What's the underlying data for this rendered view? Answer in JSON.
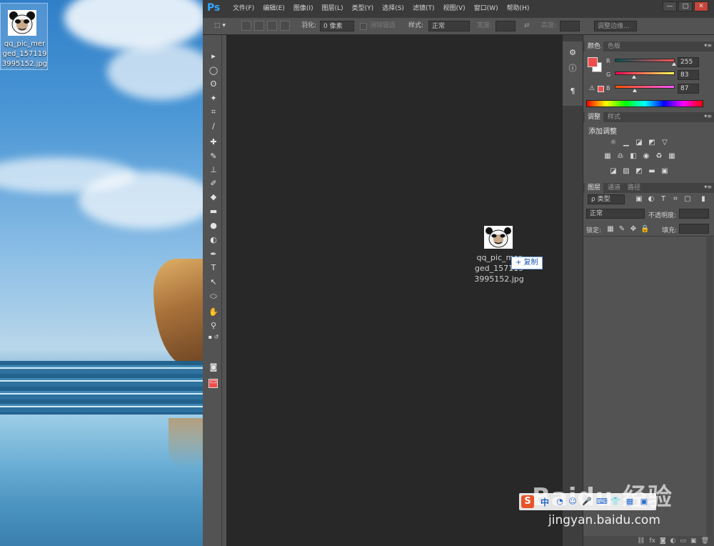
{
  "desktop": {
    "file_icon": {
      "label": "qq_pic_mer\nged_157119\n3995152.jpg"
    }
  },
  "photoshop": {
    "logo": "Ps",
    "menus": [
      "文件(F)",
      "编辑(E)",
      "图像(I)",
      "图层(L)",
      "类型(Y)",
      "选择(S)",
      "滤镜(T)",
      "视图(V)",
      "窗口(W)",
      "帮助(H)"
    ],
    "window_buttons": [
      "—",
      "□",
      "✕"
    ],
    "options_bar": {
      "feather_label": "羽化:",
      "feather_value": "0 像素",
      "antialias_label": "消除锯齿",
      "style_label": "样式:",
      "style_value": "正常",
      "width_label": "宽度:",
      "height_label": "高度:",
      "refine_edge_button": "调整边缘..."
    },
    "tools": [
      "marquee",
      "lasso",
      "magic-wand",
      "crop",
      "eyedropper",
      "healing-brush",
      "brush",
      "clone-stamp",
      "history-brush",
      "eraser",
      "gradient",
      "blur",
      "dodge",
      "pen",
      "type",
      "path-selection",
      "ellipse",
      "hand",
      "zoom"
    ],
    "colors": {
      "foreground": "#f14b4b",
      "background": "#ffffff"
    },
    "canvas": {
      "drag_preview_label": "qq_pic_mer\nged_157119\n3995152.jpg",
      "copy_badge": "+ 复制"
    },
    "color_panel": {
      "tabs": [
        "颜色",
        "色板"
      ],
      "sliders": [
        {
          "channel": "R",
          "value": "255"
        },
        {
          "channel": "G",
          "value": "83"
        },
        {
          "channel": "B",
          "value": "87"
        }
      ]
    },
    "adjustments_panel": {
      "tabs": [
        "调整",
        "样式"
      ],
      "title": "添加调整"
    },
    "layers_panel": {
      "tabs": [
        "图层",
        "通道",
        "路径"
      ],
      "filter_label": "ρ 类型",
      "blend_mode": "正常",
      "opacity_label": "不透明度:",
      "lock_label": "锁定:",
      "fill_label": "填充:"
    }
  },
  "watermark": {
    "toolbar_s": "S",
    "toolbar_cn": "中",
    "brand": "Baidu 经验",
    "url": "jingyan.baidu.com"
  }
}
